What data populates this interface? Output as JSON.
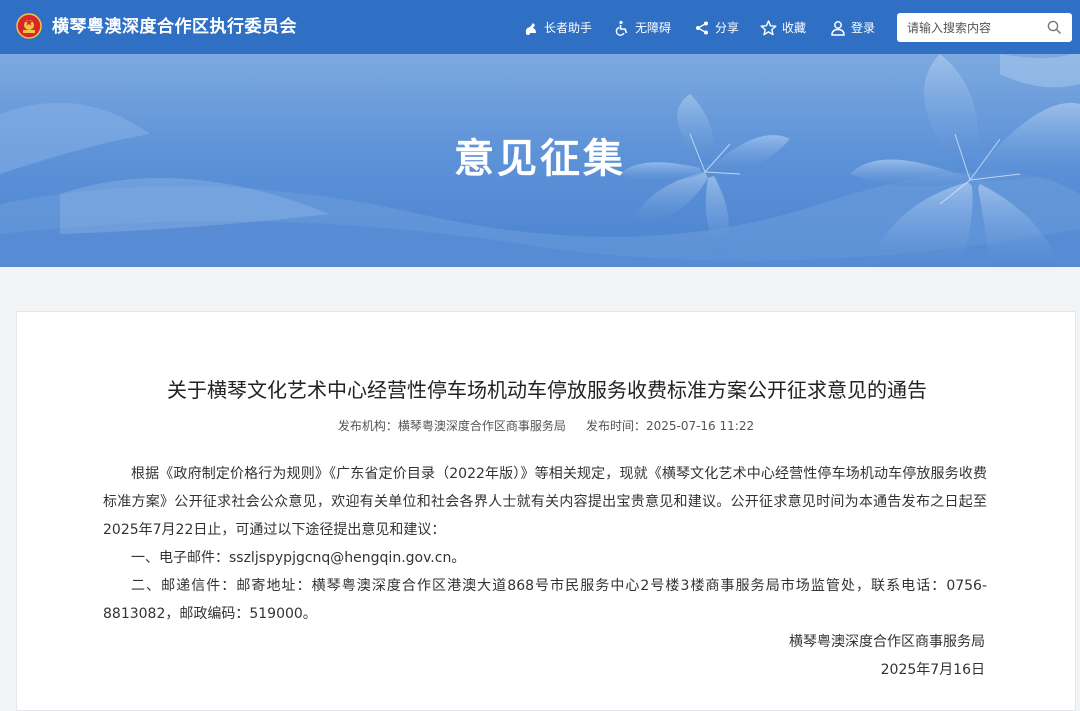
{
  "header": {
    "site_title": "横琴粤澳深度合作区执行委员会",
    "nav": {
      "elder": "长者助手",
      "accessibility": "无障碍",
      "share": "分享",
      "favorite": "收藏",
      "login": "登录"
    },
    "search": {
      "placeholder": "请输入搜索内容"
    }
  },
  "banner": {
    "title": "意见征集"
  },
  "article": {
    "title": "关于横琴文化艺术中心经营性停车场机动车停放服务收费标准方案公开征求意见的通告",
    "meta": {
      "publisher_label": "发布机构：",
      "publisher": "横琴粤澳深度合作区商事服务局",
      "time_label": "发布时间：",
      "time": "2025-07-16 11:22"
    },
    "paragraphs": [
      "根据《政府制定价格行为规则》《广东省定价目录（2022年版）》等相关规定，现就《横琴文化艺术中心经营性停车场机动车停放服务收费标准方案》公开征求社会公众意见，欢迎有关单位和社会各界人士就有关内容提出宝贵意见和建议。公开征求意见时间为本通告发布之日起至2025年7月22日止，可通过以下途径提出意见和建议：",
      "一、电子邮件：sszljspypjgcnq@hengqin.gov.cn。",
      "二、邮递信件：邮寄地址：横琴粤澳深度合作区港澳大道868号市民服务中心2号楼3楼商事服务局市场监管处，联系电话：0756-8813082，邮政编码：519000。"
    ],
    "signature": {
      "org": "横琴粤澳深度合作区商事服务局",
      "date": "2025年7月16日"
    }
  },
  "colors": {
    "header_bg": "#2f6fc4",
    "banner_bg": "#5e93d8",
    "page_bg": "#f2f3f5"
  },
  "icons": [
    "emblem-logo",
    "elder-helper-icon",
    "wheelchair-icon",
    "share-icon",
    "star-icon",
    "user-icon",
    "search-icon"
  ]
}
